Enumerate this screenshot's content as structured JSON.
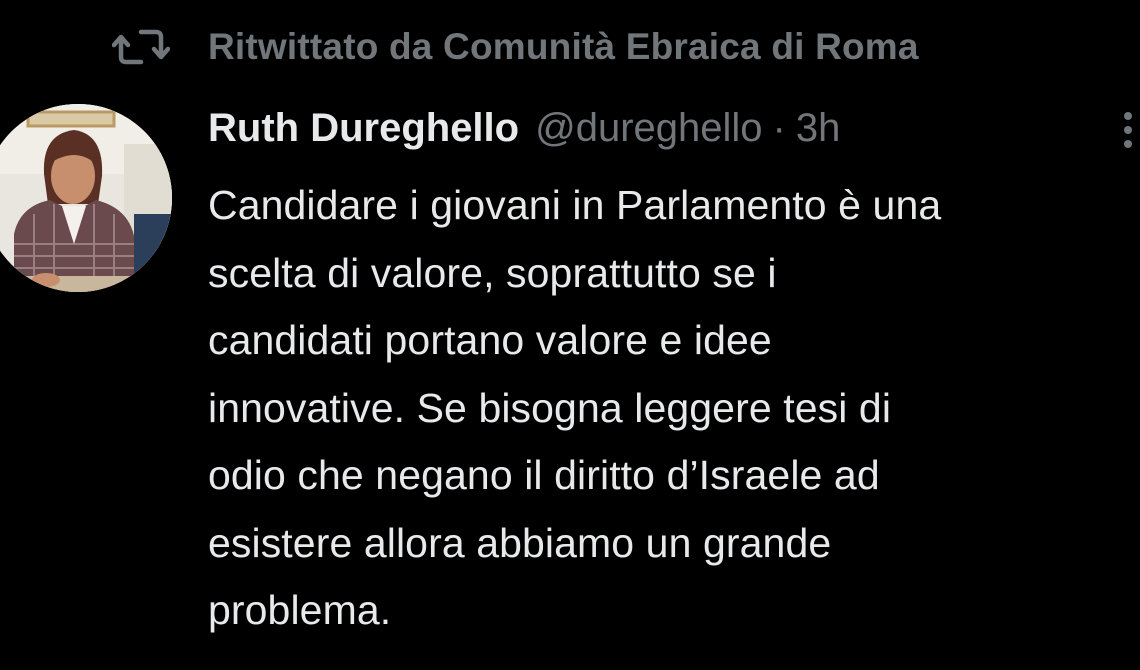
{
  "retweet": {
    "icon": "retweet-icon",
    "label": "Ritwittato da Comunità Ebraica di Roma"
  },
  "tweet": {
    "avatar": "avatar",
    "author_name": "Ruth Dureghello",
    "handle": "@dureghello",
    "separator": "·",
    "timestamp": "3h",
    "more_icon": "more-vertical-icon",
    "text_lines": [
      "Candidare i giovani in Parlamento è una",
      "scelta di valore, soprattutto se i",
      "candidati portano valore e idee",
      "innovative. Se bisogna leggere tesi di",
      "odio che negano il diritto d’Israele ad",
      "esistere allora abbiamo un grande",
      "problema."
    ]
  },
  "colors": {
    "background": "#000000",
    "primary_text": "#e7e9ea",
    "secondary_text": "#71767b"
  }
}
